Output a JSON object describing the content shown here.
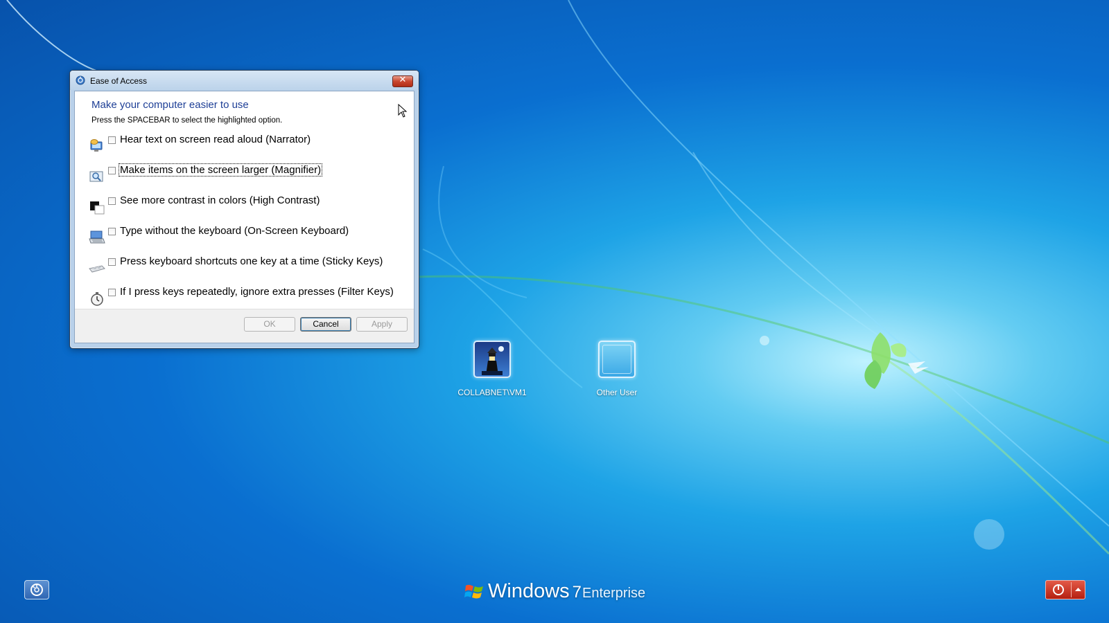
{
  "dialog": {
    "title": "Ease of Access",
    "close_label": "✕",
    "heading": "Make your computer easier to use",
    "subtext": "Press the SPACEBAR to select the highlighted option.",
    "options": [
      {
        "label": "Hear text on screen read aloud (Narrator)",
        "icon": "narrator-icon",
        "checked": false
      },
      {
        "label": "Make items on the screen larger (Magnifier)",
        "icon": "magnifier-icon",
        "checked": false
      },
      {
        "label": "See more contrast in colors (High Contrast)",
        "icon": "high-contrast-icon",
        "checked": false
      },
      {
        "label": "Type without the keyboard (On-Screen Keyboard)",
        "icon": "on-screen-keyboard-icon",
        "checked": false
      },
      {
        "label": "Press keyboard shortcuts one key at a time (Sticky Keys)",
        "icon": "sticky-keys-icon",
        "checked": false
      },
      {
        "label": "If I press keys repeatedly, ignore extra presses (Filter Keys)",
        "icon": "filter-keys-icon",
        "checked": false
      }
    ],
    "buttons": {
      "ok": "OK",
      "cancel": "Cancel",
      "apply": "Apply"
    }
  },
  "users": [
    {
      "name": "COLLABNET\\VM1"
    },
    {
      "name": "Other User"
    }
  ],
  "branding": {
    "product": "Windows",
    "version": "7",
    "edition": "Enterprise"
  },
  "colors": {
    "heading_blue": "#1e3f96",
    "close_red": "#c9472f",
    "power_red": "#c33a28",
    "desktop_blue": "#0a6fd0"
  }
}
